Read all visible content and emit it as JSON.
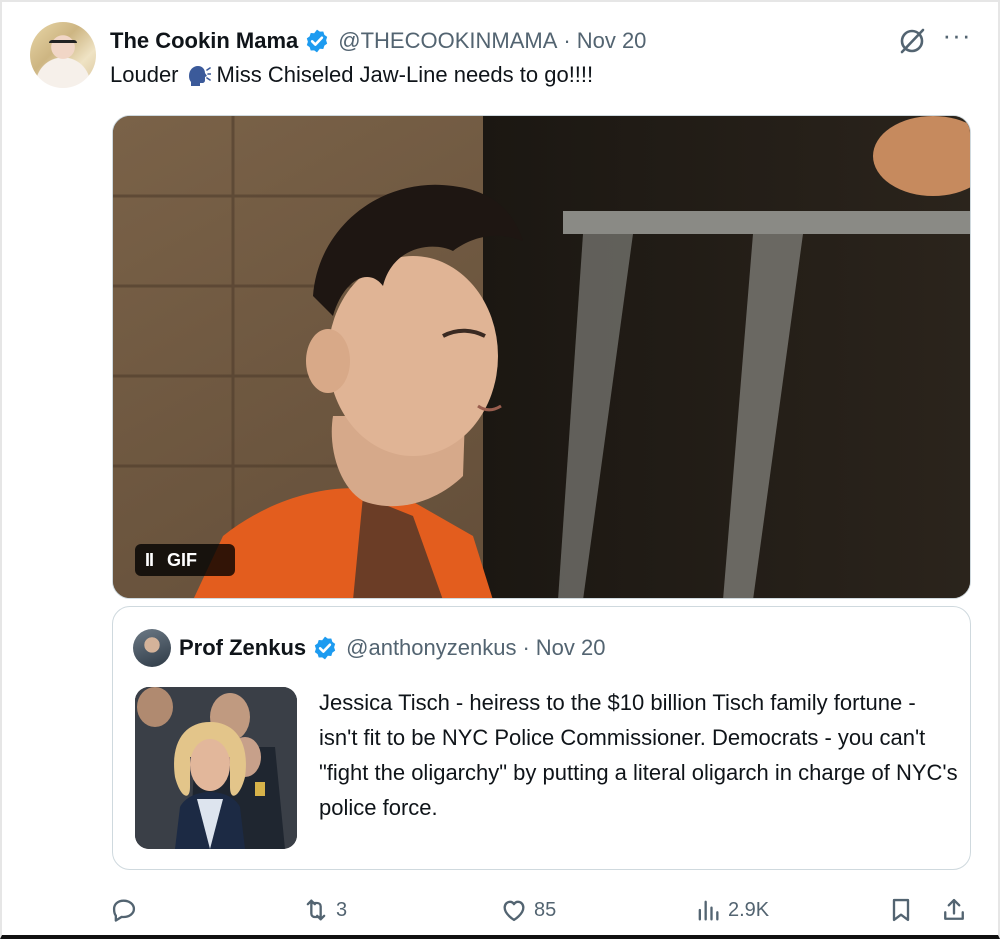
{
  "post": {
    "author_name": "The Cookin Mama",
    "handle": "@THECOOKINMAMA",
    "separator": "·",
    "date": "Nov 20",
    "text_before_emoji": "Louder",
    "text_after_emoji": "Miss Chiseled Jaw-Line needs to go!!!!",
    "emoji": "speaking-head-icon",
    "more_label": "···"
  },
  "media": {
    "pause_glyph": "II",
    "gif_label": "GIF"
  },
  "quote": {
    "author_name": "Prof Zenkus",
    "handle": "@anthonyzenkus",
    "separator": "·",
    "date": "Nov 20",
    "text": "Jessica Tisch - heiress to the $10 billion Tisch family fortune - isn't fit to be NYC Police Commissioner. Democrats - you can't \"fight the oligarchy\" by putting a literal oligarch in charge of NYC's police force."
  },
  "actions": {
    "reply_count": "",
    "repost_count": "3",
    "like_count": "85",
    "views_count": "2.9K"
  },
  "colors": {
    "verified_blue": "#1d9bf0",
    "text_primary": "#0f1419",
    "text_secondary": "#536471",
    "border": "#cfd9de"
  }
}
